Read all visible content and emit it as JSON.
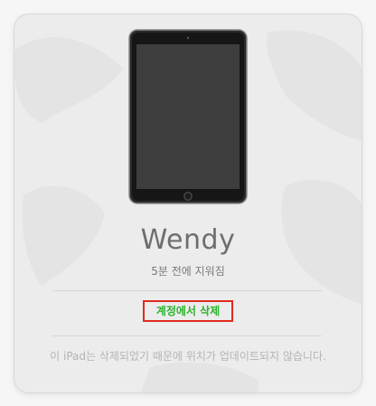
{
  "device": {
    "name": "Wendy",
    "status": "5분 전에 지워짐",
    "remove_label": "계정에서 삭제",
    "message": "이 iPad는 삭제되었기 때문에 위치가 업데이트되지 않습니다."
  },
  "colors": {
    "remove_text": "#2bb32b",
    "highlight_border": "#e02b1f"
  },
  "icons": {
    "device_image": "ipad-icon"
  }
}
